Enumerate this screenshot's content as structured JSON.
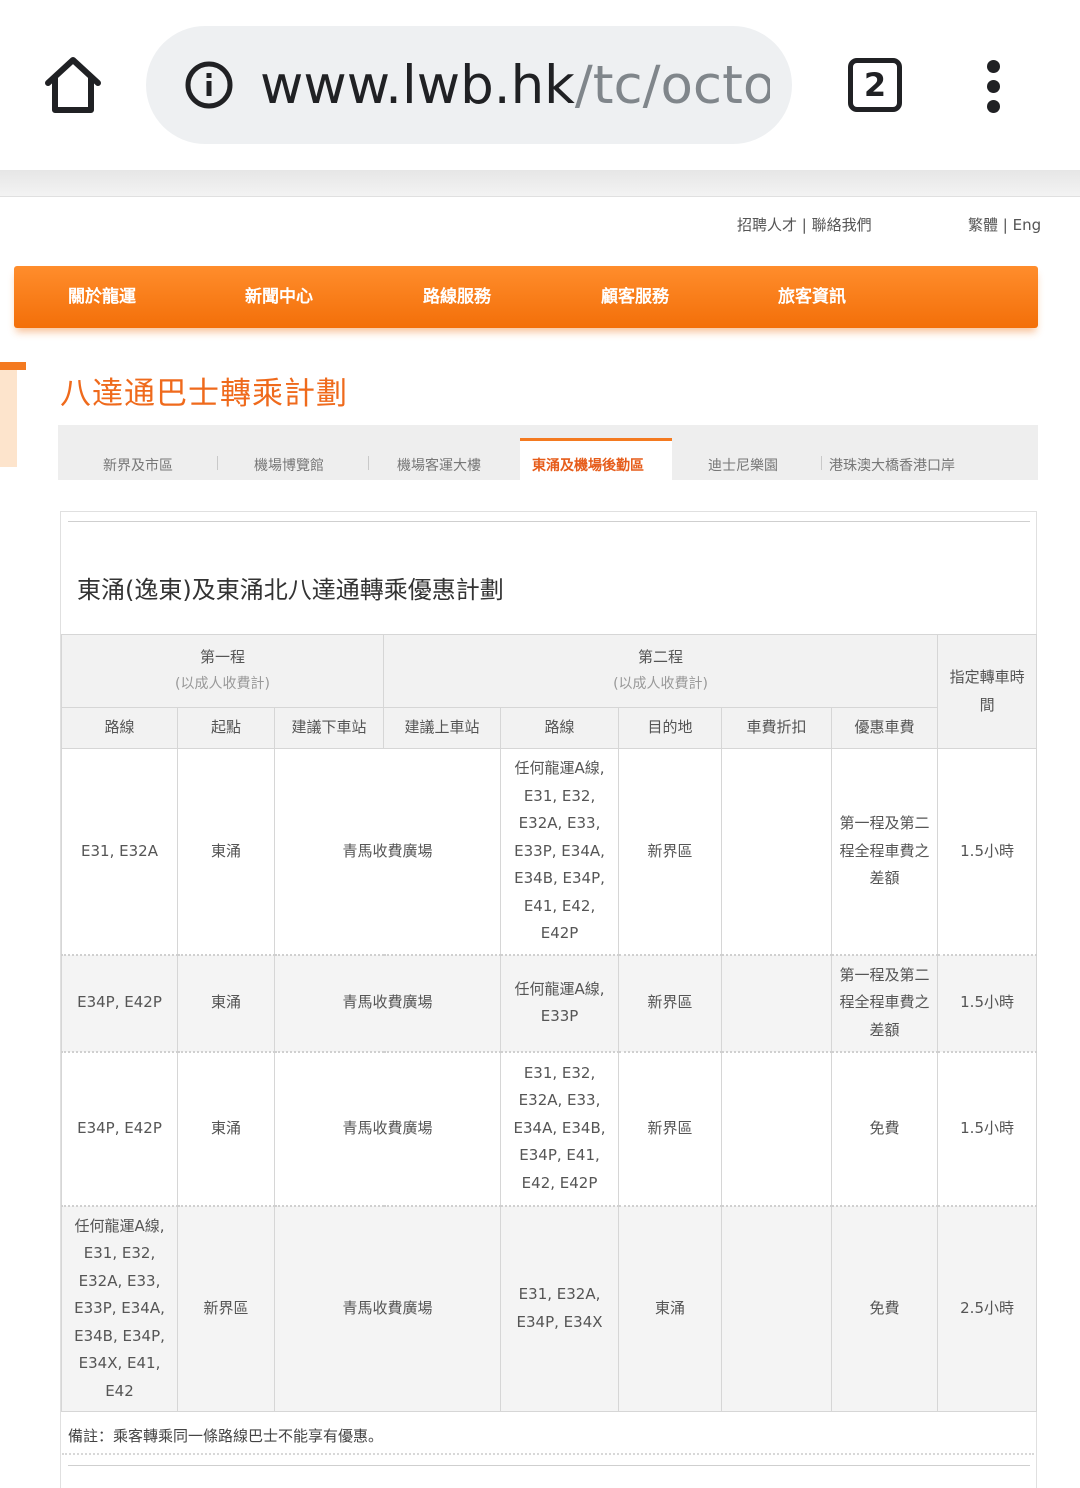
{
  "browser": {
    "url_host": "www.lwb.hk",
    "url_path": "/tc/octop",
    "tab_count": "2"
  },
  "top_links": {
    "careers": "招聘人才",
    "contact": "聯絡我們",
    "lang_tc": "繁體",
    "lang_en": "Eng"
  },
  "nav": {
    "items": [
      "關於龍運",
      "新聞中心",
      "路線服務",
      "顧客服務",
      "旅客資訊"
    ]
  },
  "page": {
    "title": "八達通巴士轉乘計劃",
    "subtabs": [
      "新界及市區",
      "機場博覽館",
      "機場客運大樓",
      "東涌及機場後勤區",
      "迪士尼樂園",
      "港珠澳大橋香港口岸"
    ],
    "active_subtab": "東涌及機場後勤區",
    "content_title": "東涌(逸東)及東涌北八達通轉乘優惠計劃"
  },
  "table": {
    "group1": "第一程",
    "group1_sub": "(以成人收費計)",
    "group2": "第二程",
    "group2_sub": "(以成人收費計)",
    "time_header": "指定轉車時間",
    "columns": [
      "路線",
      "起點",
      "建議下車站",
      "建議上車站",
      "路線",
      "目的地",
      "車費折扣",
      "優惠車費"
    ],
    "rows": [
      {
        "route1": "E31, E32A",
        "origin": "東涌",
        "interchange": "青馬收費廣場",
        "route2": "任何龍運A線, E31, E32, E32A, E33, E33P, E34A, E34B, E34P, E41, E42, E42P",
        "destination": "新界區",
        "discount": "",
        "fare": "第一程及第二程全程車費之差額",
        "time": "1.5小時"
      },
      {
        "route1": "E34P, E42P",
        "origin": "東涌",
        "interchange": "青馬收費廣場",
        "route2": "任何龍運A線, E33P",
        "destination": "新界區",
        "discount": "",
        "fare": "第一程及第二程全程車費之差額",
        "time": "1.5小時"
      },
      {
        "route1": "E34P, E42P",
        "origin": "東涌",
        "interchange": "青馬收費廣場",
        "route2": "E31, E32, E32A, E33, E34A, E34B, E34P, E41, E42, E42P",
        "destination": "新界區",
        "discount": "",
        "fare": "免費",
        "time": "1.5小時"
      },
      {
        "route1": "任何龍運A線, E31, E32, E32A, E33, E33P, E34A, E34B, E34P, E34X, E41, E42",
        "origin": "新界區",
        "interchange": "青馬收費廣場",
        "route2": "E31, E32A, E34P, E34X",
        "destination": "東涌",
        "discount": "",
        "fare": "免費",
        "time": "2.5小時"
      }
    ],
    "note": "備註：乘客轉乘同一條路線巴士不能享有優惠。"
  }
}
